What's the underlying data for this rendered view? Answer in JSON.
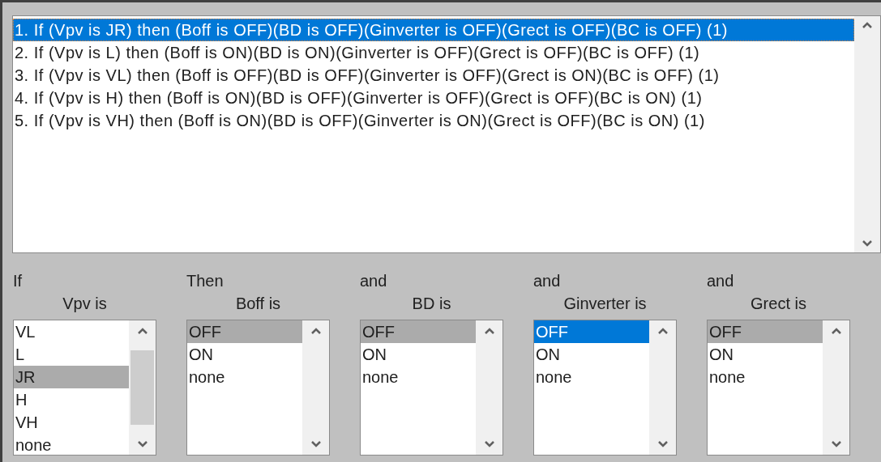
{
  "rules": [
    {
      "text": "1. If (Vpv is JR) then (Boff is OFF)(BD is OFF)(Ginverter is OFF)(Grect is OFF)(BC is OFF) (1)",
      "selected": true
    },
    {
      "text": "2. If (Vpv is L) then (Boff is ON)(BD is ON)(Ginverter is OFF)(Grect is OFF)(BC is OFF) (1)",
      "selected": false
    },
    {
      "text": "3. If (Vpv is VL) then (Boff is OFF)(BD is OFF)(Ginverter is OFF)(Grect is ON)(BC is OFF) (1)",
      "selected": false
    },
    {
      "text": "4. If (Vpv is H) then (Boff is ON)(BD is OFF)(Ginverter is OFF)(Grect is OFF)(BC is ON) (1)",
      "selected": false
    },
    {
      "text": "5. If (Vpv is VH) then (Boff is ON)(BD is OFF)(Ginverter is ON)(Grect is OFF)(BC is ON) (1)",
      "selected": false
    }
  ],
  "variables": [
    {
      "connective": "If",
      "label": "Vpv is",
      "focused": false,
      "scrollable": true,
      "options": [
        {
          "label": "VL",
          "selected": false
        },
        {
          "label": "L",
          "selected": false
        },
        {
          "label": "JR",
          "selected": true
        },
        {
          "label": "H",
          "selected": false
        },
        {
          "label": "VH",
          "selected": false
        },
        {
          "label": "none",
          "selected": false
        }
      ]
    },
    {
      "connective": "Then",
      "label": "Boff is",
      "focused": false,
      "scrollable": false,
      "options": [
        {
          "label": "OFF",
          "selected": true
        },
        {
          "label": "ON",
          "selected": false
        },
        {
          "label": "none",
          "selected": false
        }
      ]
    },
    {
      "connective": "and",
      "label": "BD is",
      "focused": false,
      "scrollable": false,
      "options": [
        {
          "label": "OFF",
          "selected": true
        },
        {
          "label": "ON",
          "selected": false
        },
        {
          "label": "none",
          "selected": false
        }
      ]
    },
    {
      "connective": "and",
      "label": "Ginverter is",
      "focused": true,
      "scrollable": false,
      "options": [
        {
          "label": "OFF",
          "selected": true
        },
        {
          "label": "ON",
          "selected": false
        },
        {
          "label": "none",
          "selected": false
        }
      ]
    },
    {
      "connective": "and",
      "label": "Grect is",
      "focused": false,
      "scrollable": false,
      "options": [
        {
          "label": "OFF",
          "selected": true
        },
        {
          "label": "ON",
          "selected": false
        },
        {
          "label": "none",
          "selected": false
        }
      ]
    }
  ]
}
